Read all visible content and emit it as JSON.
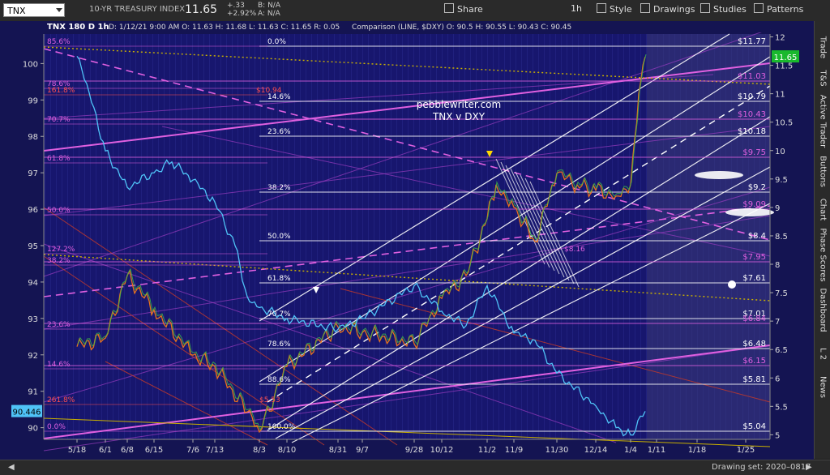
{
  "toolbar": {
    "symbol": "TNX",
    "title": "10-YR TREASURY INDEX",
    "price": "11.65",
    "change": "+.33",
    "change_pct": "+2.92%",
    "bid": "B: N/A",
    "ask": "A: N/A",
    "share": "Share",
    "interval": "1h",
    "style": "Style",
    "drawings": "Drawings",
    "studies": "Studies",
    "patterns": "Patterns"
  },
  "right_tabs": [
    "Trade",
    "T&S",
    "Active Trader",
    "Buttons",
    "Chart",
    "Phase Scores",
    "Dashboard",
    "L 2",
    "News"
  ],
  "bottom": {
    "drawing_set": "Drawing set: 2020–0817"
  },
  "chart_data": {
    "type": "line",
    "header": "TNX 180 D 1h",
    "ohlc": "D: 1/12/21 9:00 AM  O: 11.63  H: 11.68  L: 11.63  C: 11.65  R: 0.05",
    "comparison": "Comparison (LINE, $DXY)  O: 90.5  H: 90.55  L: 90.43  C: 90.45",
    "annotation": [
      "pebblewriter.com",
      "TNX v DXY"
    ],
    "right_axis": {
      "ticks": [
        5,
        5.5,
        6,
        6.5,
        7,
        7.5,
        8,
        8.5,
        9,
        9.5,
        10,
        10.5,
        11,
        11.5,
        12
      ],
      "range": [
        4.92,
        12.05
      ],
      "current": "11.65"
    },
    "left_axis": {
      "ticks": [
        90,
        91,
        92,
        93,
        94,
        95,
        96,
        97,
        98,
        99,
        100
      ],
      "range": [
        89.68,
        100.81
      ],
      "current": "90.446"
    },
    "x_ticks": [
      "5/18",
      "6/1",
      "6/8",
      "6/15",
      "7/6",
      "7/13",
      "8/3",
      "8/10",
      "8/31",
      "9/7",
      "9/28",
      "10/12",
      "11/2",
      "11/9",
      "11/30",
      "12/14",
      "1/4",
      "1/11",
      "1/18",
      "1/25"
    ],
    "fib_levels": [
      {
        "pct": "0.0%",
        "value": "$11.77"
      },
      {
        "pct": "14.6%",
        "value": "$10.79"
      },
      {
        "pct": "23.6%",
        "value": "$10.18"
      },
      {
        "pct": "38.2%",
        "value": "$9.2"
      },
      {
        "pct": "50.0%",
        "value": "$8.4"
      },
      {
        "pct": "61.8%",
        "value": "$7.61"
      },
      {
        "pct": "70.7%",
        "value": "$7.01"
      },
      {
        "pct": "78.6%",
        "value": "$6.48"
      },
      {
        "pct": "88.6%",
        "value": "$5.81"
      },
      {
        "pct": "100.0%",
        "value": "$5.04"
      }
    ],
    "magenta_levels": [
      "$11.03",
      "$10.43",
      "$9.75",
      "$9.09",
      "$7.95",
      "$6.84",
      "$6.15"
    ],
    "left_labels": [
      "85.6%",
      "78.6%",
      "161.8%",
      "70.7%",
      "61.8%",
      "50.0%",
      "127.2%",
      "38.2%",
      "23.6%",
      "14.6%",
      "261.8%",
      "0.0%"
    ],
    "misc_labels": [
      "$10.94",
      "$8.16",
      "$5.53"
    ],
    "tnx_series": [
      [
        "5/18",
        6.55
      ],
      [
        "6/1",
        6.7
      ],
      [
        "6/8",
        7.8
      ],
      [
        "6/15",
        7.2
      ],
      [
        "7/6",
        6.4
      ],
      [
        "7/13",
        6.2
      ],
      [
        "7/27",
        5.4
      ],
      [
        "8/3",
        5.05
      ],
      [
        "8/10",
        6.2
      ],
      [
        "8/31",
        6.9
      ],
      [
        "9/7",
        6.8
      ],
      [
        "9/28",
        6.6
      ],
      [
        "10/12",
        7.4
      ],
      [
        "10/19",
        7.8
      ],
      [
        "11/2",
        8.8
      ],
      [
        "11/5",
        9.4
      ],
      [
        "11/9",
        9.0
      ],
      [
        "11/16",
        8.4
      ],
      [
        "11/30",
        9.6
      ],
      [
        "12/7",
        9.4
      ],
      [
        "12/14",
        9.3
      ],
      [
        "12/28",
        9.2
      ],
      [
        "1/4",
        9.4
      ],
      [
        "1/6",
        10.2
      ],
      [
        "1/8",
        11.0
      ],
      [
        "1/12",
        11.65
      ]
    ],
    "dxy_series": [
      [
        "5/18",
        100.2
      ],
      [
        "5/25",
        99.2
      ],
      [
        "6/1",
        97.6
      ],
      [
        "6/8",
        96.6
      ],
      [
        "6/15",
        97.0
      ],
      [
        "6/22",
        97.3
      ],
      [
        "7/6",
        96.8
      ],
      [
        "7/13",
        96.2
      ],
      [
        "7/20",
        95.0
      ],
      [
        "7/27",
        93.6
      ],
      [
        "8/3",
        93.3
      ],
      [
        "8/10",
        93.0
      ],
      [
        "8/31",
        92.7
      ],
      [
        "9/7",
        93.0
      ],
      [
        "9/28",
        93.9
      ],
      [
        "10/12",
        93.2
      ],
      [
        "10/19",
        92.8
      ],
      [
        "11/2",
        93.9
      ],
      [
        "11/9",
        92.6
      ],
      [
        "11/16",
        92.4
      ],
      [
        "11/30",
        91.5
      ],
      [
        "12/14",
        90.6
      ],
      [
        "12/28",
        90.0
      ],
      [
        "1/4",
        89.8
      ],
      [
        "1/12",
        90.45
      ]
    ]
  }
}
